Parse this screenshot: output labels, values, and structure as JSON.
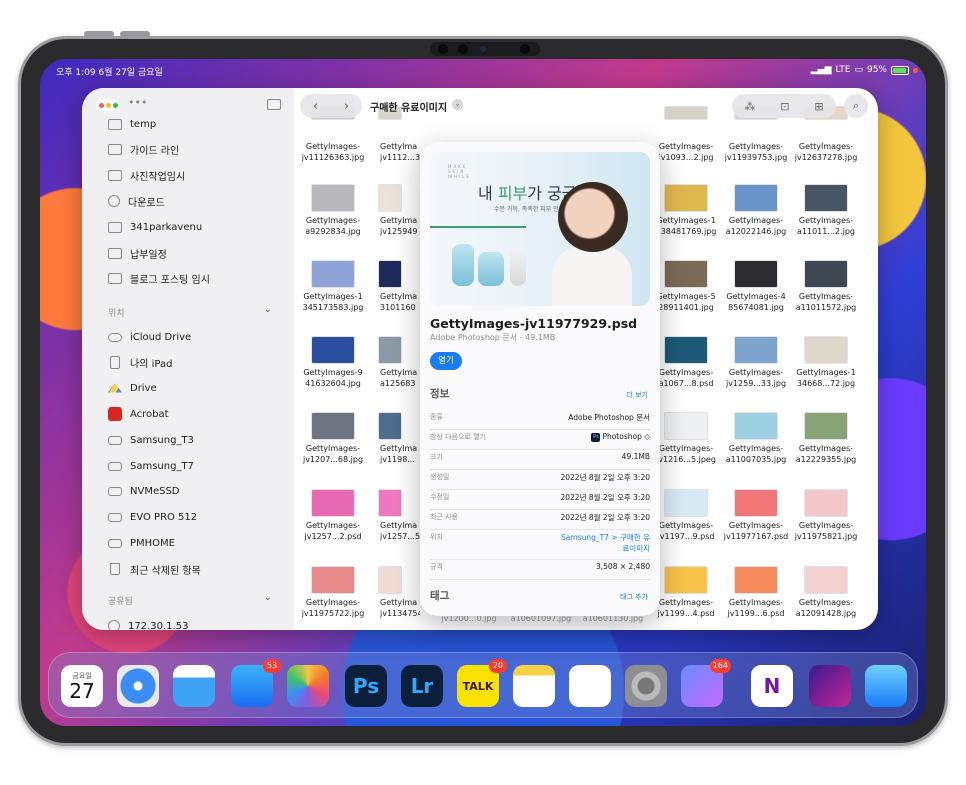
{
  "status_bar": {
    "time_date": "오후 1:09  6월 27일 금요일",
    "signal": "LTE",
    "battery": "95%"
  },
  "finder": {
    "location": "구매한 유료이미지",
    "sidebar": {
      "favorites": [
        {
          "label": "temp",
          "icon": "folder-icon"
        },
        {
          "label": "가이드 라인",
          "icon": "folder-icon"
        },
        {
          "label": "사진작업임시",
          "icon": "folder-icon"
        },
        {
          "label": "다운로드",
          "icon": "download-icon"
        },
        {
          "label": "341parkavenu",
          "icon": "folder-icon"
        },
        {
          "label": "납부일정",
          "icon": "folder-icon"
        },
        {
          "label": "블로그 포스팅 임시",
          "icon": "folder-icon"
        }
      ],
      "locations_header": "위치",
      "locations": [
        {
          "label": "iCloud Drive",
          "icon": "cloud-icon"
        },
        {
          "label": "나의 iPad",
          "icon": "ipad-icon"
        },
        {
          "label": "Drive",
          "icon": "google-drive-icon"
        },
        {
          "label": "Acrobat",
          "icon": "acrobat-icon"
        },
        {
          "label": "Samsung_T3",
          "icon": "drive-icon"
        },
        {
          "label": "Samsung_T7",
          "icon": "drive-icon"
        },
        {
          "label": "NVMeSSD",
          "icon": "drive-icon"
        },
        {
          "label": "EVO PRO 512",
          "icon": "drive-icon"
        },
        {
          "label": "PMHOME",
          "icon": "drive-icon"
        },
        {
          "label": "최근 삭제된 항목",
          "icon": "trash-icon"
        }
      ],
      "shared_header": "공유됨",
      "shared": [
        {
          "label": "172.30.1.53",
          "icon": "network-icon"
        }
      ]
    },
    "files": [
      {
        "name": "GettyImages-jv11126363.jpg",
        "color": "#c9cdd4"
      },
      {
        "name": "GettyIma jv1112...3",
        "color": "#d9d4cc"
      },
      {
        "name": "GettyImages- jv1093...2.jpg",
        "color": "#d6d2c6"
      },
      {
        "name": "GettyImages- jv11939753.jpg",
        "color": "#cfd6de"
      },
      {
        "name": "GettyImages- jv12637278.jpg",
        "color": "#e4d7c4"
      },
      {
        "name": "GettyImages- a9292834.jpg",
        "color": "#b9b9bd"
      },
      {
        "name": "GettyIma jv125949",
        "color": "#e9e3dc"
      },
      {
        "name": "GettyImages-1 338481769.jpg",
        "color": "#e0b850"
      },
      {
        "name": "GettyImages- a12022146.jpg",
        "color": "#6b94c8"
      },
      {
        "name": "GettyImages- a11011...2.jpg",
        "color": "#4a5563"
      },
      {
        "name": "GettyImages-1 345173583.jpg",
        "color": "#8fa3d8"
      },
      {
        "name": "GettyIma 3101160",
        "color": "#1d2a5c"
      },
      {
        "name": "GettyImages-5 28911401.jpg",
        "color": "#7b6b56"
      },
      {
        "name": "GettyImages-4 85674081.jpg",
        "color": "#2d2d30"
      },
      {
        "name": "GettyImages- a11011572.jpg",
        "color": "#3e4652"
      },
      {
        "name": "GettyImages-9 41632604.jpg",
        "color": "#2a4fa0"
      },
      {
        "name": "GettyIma a125683",
        "color": "#8c9aa6"
      },
      {
        "name": "GettyImages- a1067...8.psd",
        "color": "#1e5a78"
      },
      {
        "name": "GettyImages- jv1259...33.jpg",
        "color": "#7ea3cc"
      },
      {
        "name": "GettyImages-1 34668...72.jpg",
        "color": "#dfd8cd"
      },
      {
        "name": "GettyImages- jv1207...68.jpg",
        "color": "#6d7480"
      },
      {
        "name": "GettyIma jv1198...",
        "color": "#4e6c8c"
      },
      {
        "name": "GettyImages- jv1216...5.jpeg",
        "color": "#eef0f2"
      },
      {
        "name": "GettyImages- a11007035.jpg",
        "color": "#9ccfe0"
      },
      {
        "name": "GettyImages- a12229355.jpg",
        "color": "#88a476"
      },
      {
        "name": "GettyImages- jv1257...2.psd",
        "color": "#e86ab2"
      },
      {
        "name": "GettyIma jv1257...5",
        "color": "#ee78c0"
      },
      {
        "name": "GettyImages- jv1197...9.psd",
        "color": "#d8eaf4"
      },
      {
        "name": "GettyImages- jv11977167.psd",
        "color": "#f07878"
      },
      {
        "name": "GettyImages- jv11975821.jpg",
        "color": "#f2c8cc"
      },
      {
        "name": "GettyImages- jv11975722.jpg",
        "color": "#e88a8a"
      },
      {
        "name": "GettyIma jv11347540.jpg",
        "color": "#f0dcd4"
      },
      {
        "name": "GettyImages- jv1199...4.psd",
        "color": "#f7c34a"
      },
      {
        "name": "GettyImages- jv1199...6.psd",
        "color": "#f58a5a"
      },
      {
        "name": "GettyImages- a12091428.jpg",
        "color": "#f5d2d2"
      }
    ],
    "bottom_partial": [
      "jv1200...0.jpg",
      "a10601097.jpg",
      "a10601130.jpg"
    ]
  },
  "quicklook": {
    "preview": {
      "brand": "MAKE SKIN WHILE",
      "headline_part1": "내 ",
      "headline_accent": "피부",
      "headline_part2": "가 궁금해?",
      "subline": "수분 가득, 촉촉한 피부 만들기"
    },
    "filename": "GettyImages-jv11977929.psd",
    "subtitle": "Adobe Photoshop 문서 - 49.1MB",
    "open_label": "열기",
    "info_header": "정보",
    "more_label": "더 보기",
    "info_rows": [
      {
        "key": "종류",
        "value": "Adobe Photoshop 문서"
      },
      {
        "key": "항상 다음으로 열기",
        "value": "Photoshop ◇"
      },
      {
        "key": "크기",
        "value": "49.1MB"
      },
      {
        "key": "생성일",
        "value": "2022년 8월 2일 오후 3:20"
      },
      {
        "key": "수정일",
        "value": "2022년 8월 2일 오후 3:20"
      },
      {
        "key": "최근 사용",
        "value": "2022년 8월 2일 오후 3:20"
      },
      {
        "key": "위치",
        "value": "Samsung_T7 > 구매한 유료이미지"
      },
      {
        "key": "규격",
        "value": "3,508 × 2,480"
      }
    ],
    "tags_header": "태그",
    "add_tag_label": "태그 추가"
  },
  "dock": {
    "calendar_weekday": "금요일",
    "calendar_day": "27",
    "apps": [
      {
        "name": "calendar-app",
        "label": "",
        "badge": ""
      },
      {
        "name": "safari-app",
        "label": "",
        "badge": ""
      },
      {
        "name": "files-app",
        "label": "",
        "badge": ""
      },
      {
        "name": "mail-app",
        "label": "",
        "badge": "53"
      },
      {
        "name": "photos-app",
        "label": "",
        "badge": ""
      },
      {
        "name": "photoshop-app",
        "label": "Ps",
        "badge": ""
      },
      {
        "name": "lightroom-app",
        "label": "Lr",
        "badge": ""
      },
      {
        "name": "kakaotalk-app",
        "label": "TALK",
        "badge": "20"
      },
      {
        "name": "notes-app",
        "label": "",
        "badge": ""
      },
      {
        "name": "chatgpt-app",
        "label": "",
        "badge": ""
      },
      {
        "name": "settings-app",
        "label": "",
        "badge": ""
      },
      {
        "name": "app-folder",
        "label": "",
        "badge": "164"
      },
      {
        "name": "onenote-app",
        "label": "N",
        "badge": ""
      },
      {
        "name": "shortcuts-app",
        "label": "",
        "badge": ""
      },
      {
        "name": "utility-app",
        "label": "",
        "badge": ""
      }
    ]
  }
}
